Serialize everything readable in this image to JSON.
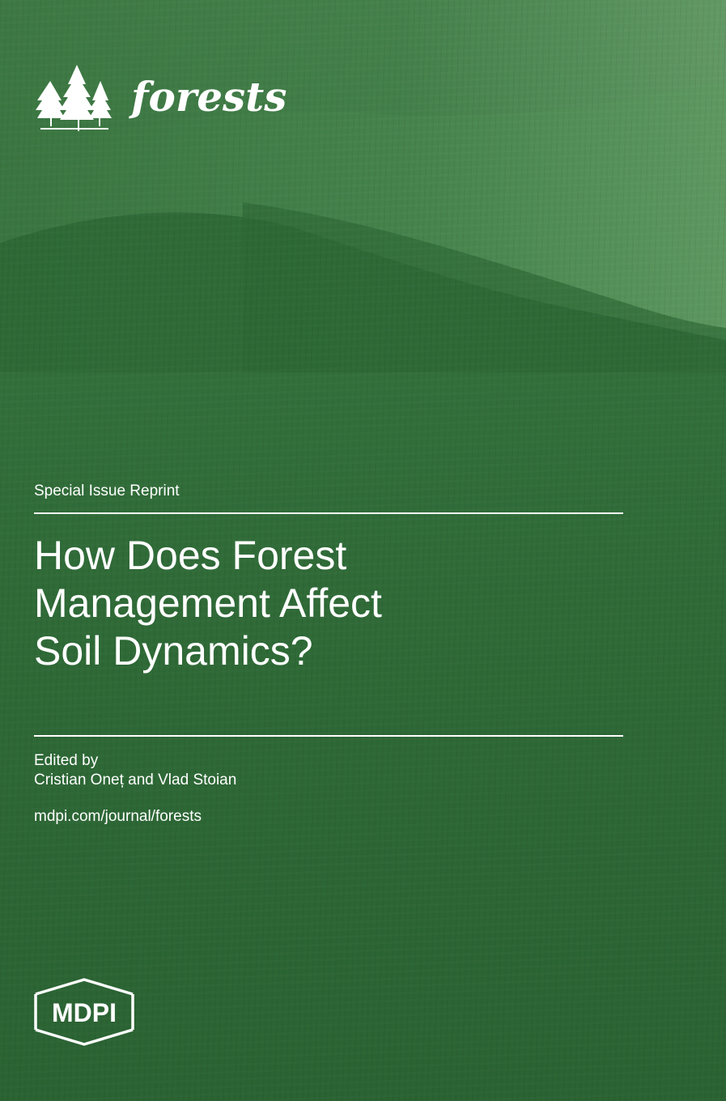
{
  "journal": {
    "name": "forests",
    "logo_icon": "trees-icon"
  },
  "cover": {
    "label": "Special Issue Reprint",
    "title_lines": [
      "How Does Forest",
      "Management Affect",
      "Soil Dynamics?"
    ],
    "edited_by_label": "Edited by",
    "editors": "Cristian Oneț and Vlad Stoian",
    "url": "mdpi.com/journal/forests"
  },
  "publisher": {
    "name": "MDPI",
    "logo_icon": "mdpi-hexagon-icon"
  },
  "colors": {
    "background": "#2e6636",
    "text": "#ffffff"
  }
}
